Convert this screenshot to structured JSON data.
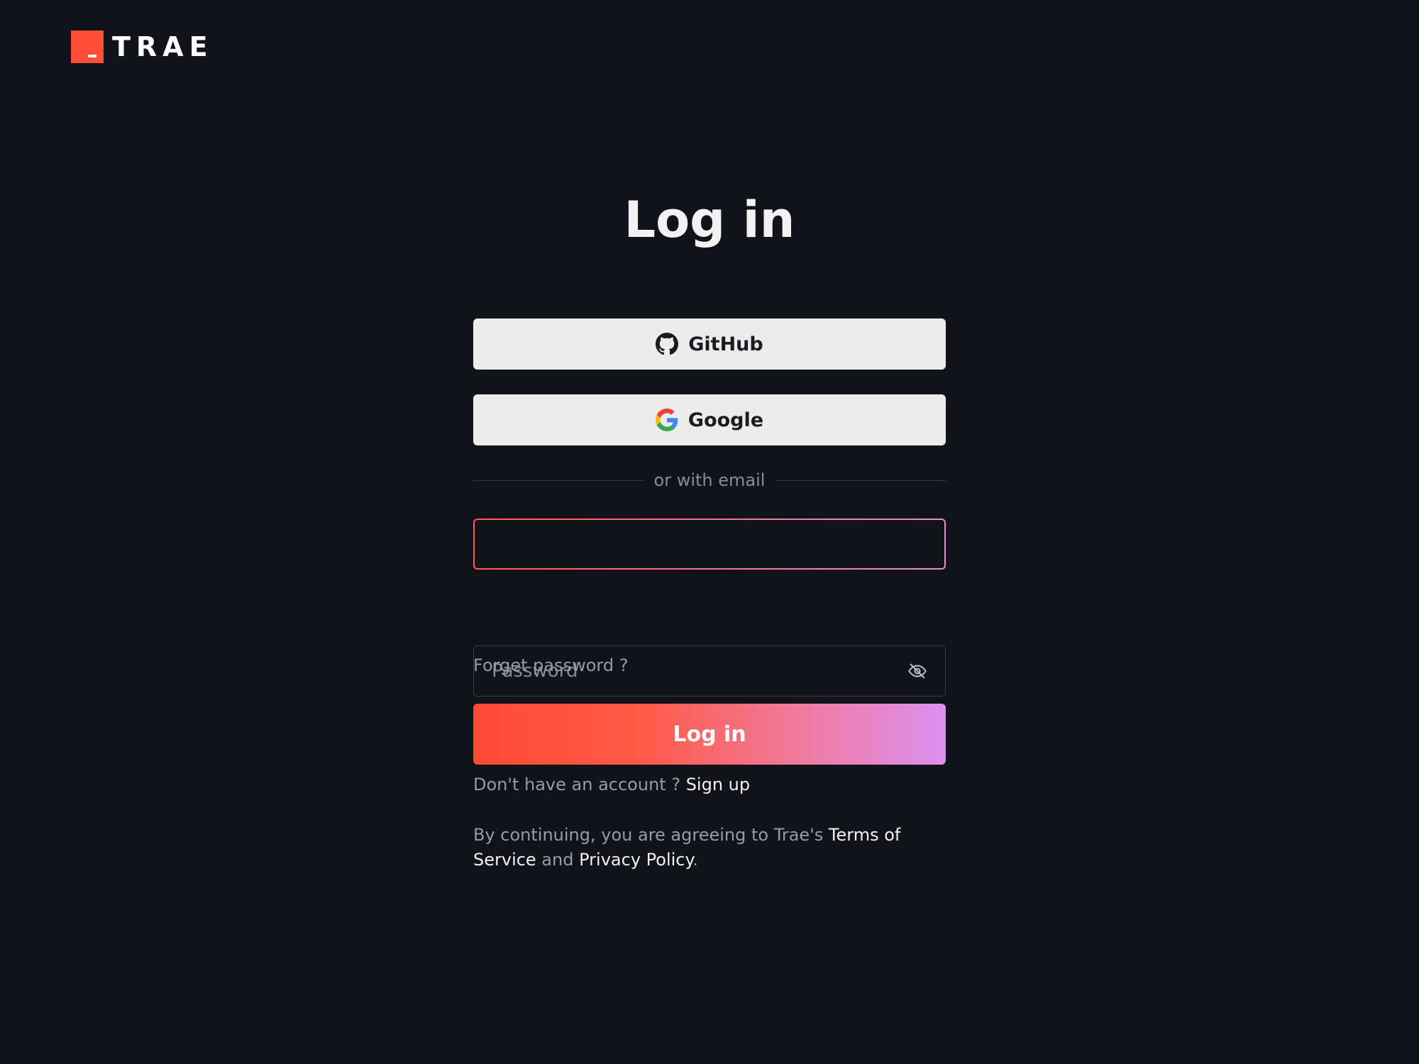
{
  "brand": {
    "name": "TRAE",
    "accent_color": "#ff4d36"
  },
  "page": {
    "title": "Log in"
  },
  "oauth": [
    {
      "label": "GitHub",
      "icon": "github-icon"
    },
    {
      "label": "Google",
      "icon": "google-icon"
    }
  ],
  "divider": {
    "text": "or with email"
  },
  "form": {
    "email": {
      "value": "",
      "placeholder": ""
    },
    "password": {
      "value": "",
      "placeholder": "Password",
      "toggle_icon": "eye-off-icon"
    },
    "forget_link": "Forget password ?",
    "submit_label": "Log in"
  },
  "signup": {
    "prompt": "Don't have an account ? ",
    "link": "Sign up"
  },
  "legal": {
    "prefix": "By continuing, you are agreeing to Trae's ",
    "terms_link": "Terms of Service",
    "middle": " and ",
    "privacy_link": "Privacy Policy",
    "suffix": "."
  },
  "colors": {
    "background": "#11121a",
    "button_light": "#ececec",
    "gradient_start": "#ff4a35",
    "gradient_end": "#dc90f0"
  }
}
